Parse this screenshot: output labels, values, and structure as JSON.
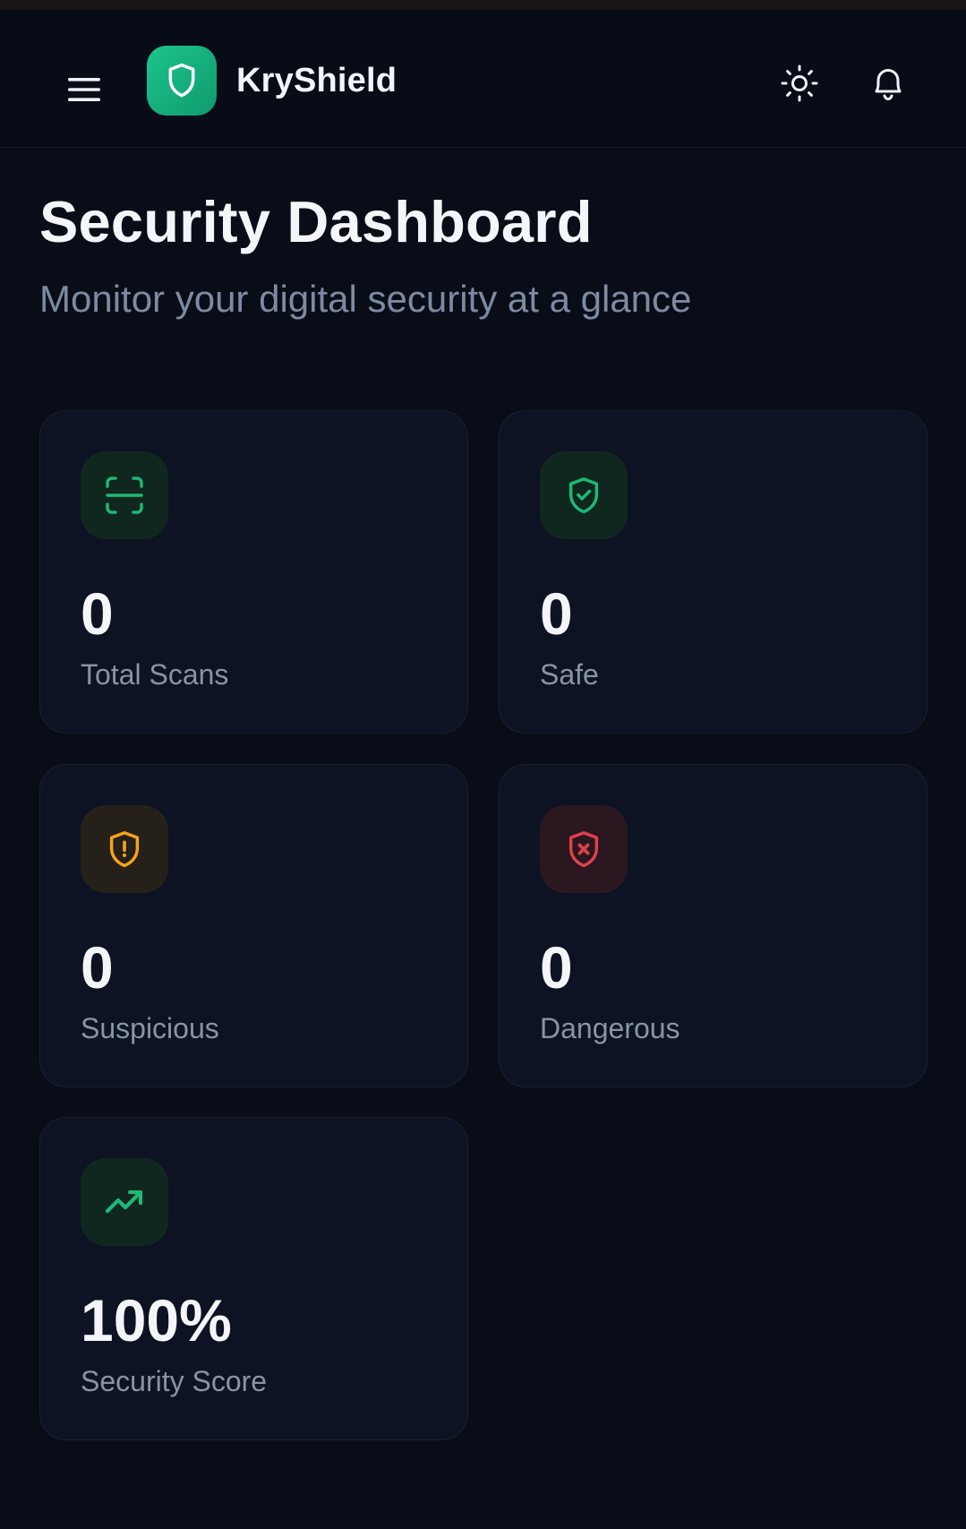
{
  "app": {
    "brand": "KryShield",
    "accent_color": "#17b07c",
    "icons": {
      "menu": "hamburger-menu-icon",
      "logo": "shield-icon",
      "theme": "sun-icon",
      "notifications": "bell-icon"
    }
  },
  "page": {
    "title": "Security Dashboard",
    "subtitle": "Monitor your digital security at a glance"
  },
  "stats": [
    {
      "id": "total",
      "value": "0",
      "label": "Total Scans",
      "icon": "scan-icon",
      "color": "#1fb877"
    },
    {
      "id": "safe",
      "value": "0",
      "label": "Safe",
      "icon": "shield-check-icon",
      "color": "#1fb877"
    },
    {
      "id": "suspicious",
      "value": "0",
      "label": "Suspicious",
      "icon": "shield-alert-icon",
      "color": "#f2a518"
    },
    {
      "id": "dangerous",
      "value": "0",
      "label": "Dangerous",
      "icon": "shield-x-icon",
      "color": "#e0414a"
    },
    {
      "id": "score",
      "value": "100%",
      "label": "Security Score",
      "icon": "trending-up-icon",
      "color": "#1fb877"
    }
  ]
}
